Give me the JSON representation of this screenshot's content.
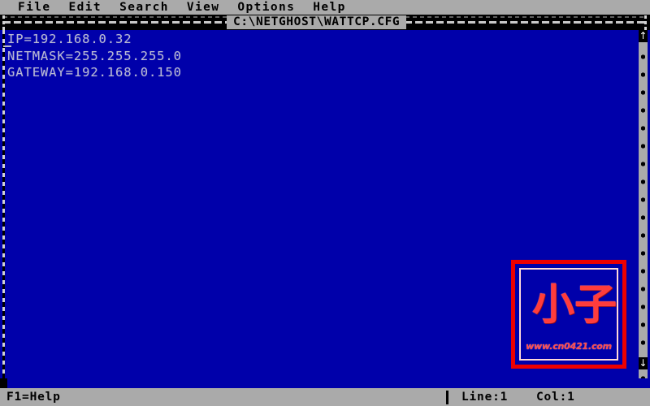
{
  "window": {
    "title": "C:\\NETGHOST\\WATTCP.CFG"
  },
  "menubar": {
    "items": [
      {
        "label": "File",
        "name": "menu-file"
      },
      {
        "label": "Edit",
        "name": "menu-edit"
      },
      {
        "label": "Search",
        "name": "menu-search"
      },
      {
        "label": "View",
        "name": "menu-view"
      },
      {
        "label": "Options",
        "name": "menu-options"
      },
      {
        "label": "Help",
        "name": "menu-help"
      }
    ]
  },
  "editor": {
    "lines": [
      "IP=192.168.0.32",
      "NETMASK=255.255.255.0",
      "GATEWAY=192.168.0.150"
    ]
  },
  "scrollbar": {
    "up_arrow": "↑",
    "down_arrow": "↓"
  },
  "logo": {
    "glyph_left": "小",
    "glyph_right": "子",
    "url": "www.cn0421.com",
    "border_color": "#ee0000"
  },
  "statusbar": {
    "help": "F1=Help",
    "line": "Line:1",
    "col": "Col:1"
  },
  "colors": {
    "editor_background": "#0000aa",
    "chrome": "#aaaaaa",
    "text": "#b9b9d2",
    "accent_red": "#ee0000"
  }
}
